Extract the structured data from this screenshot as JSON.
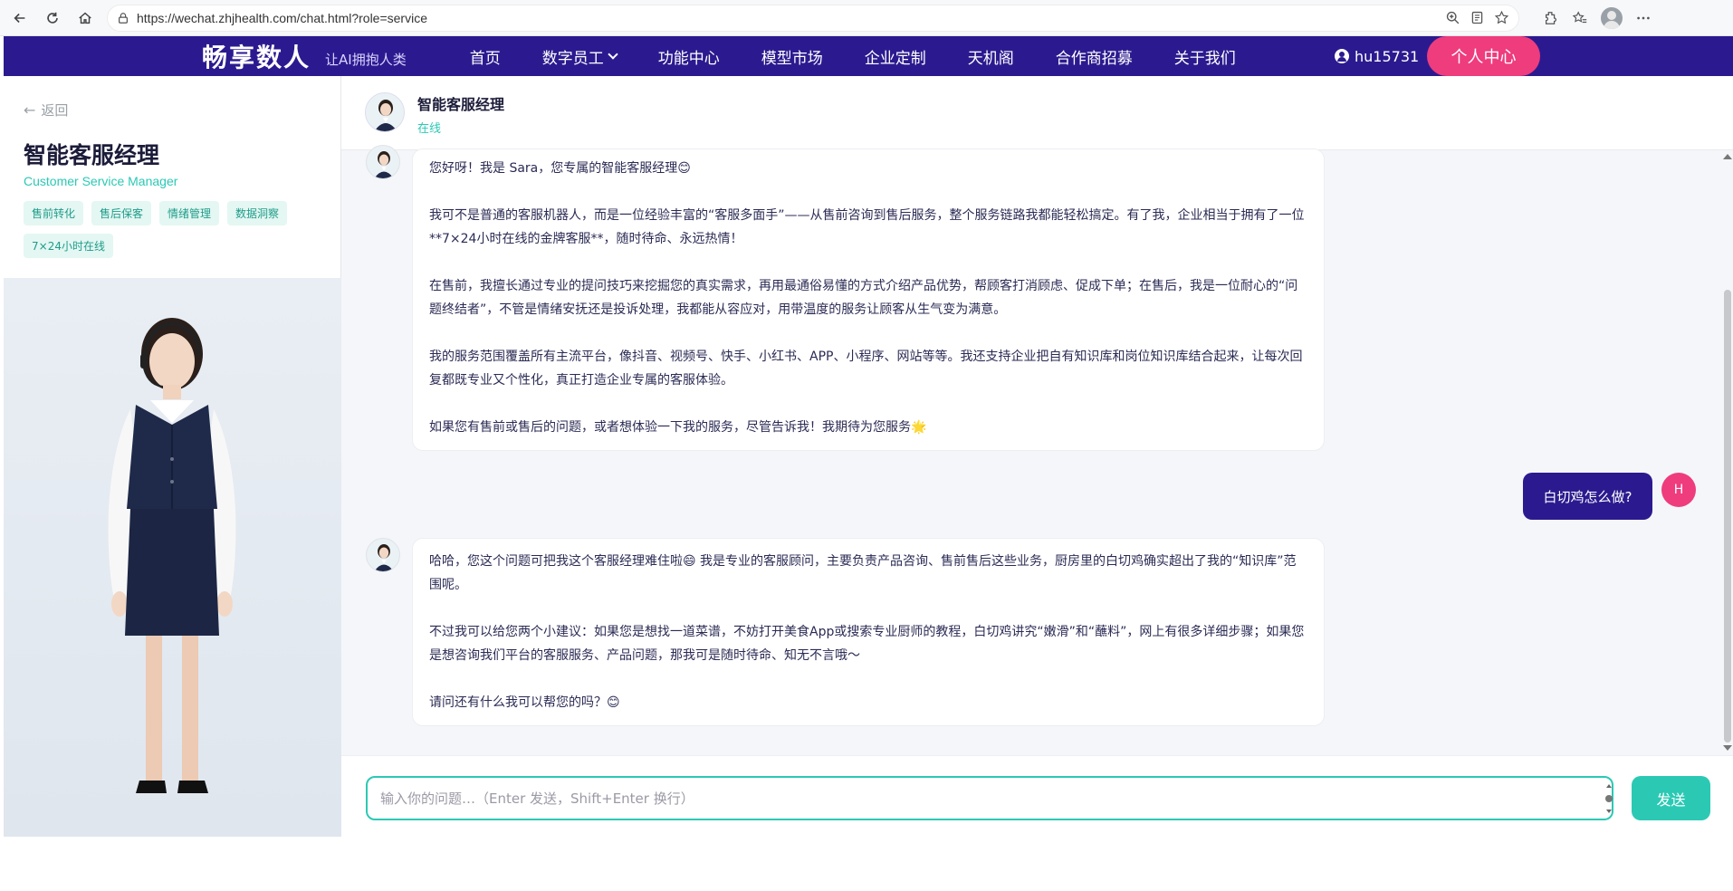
{
  "browser": {
    "url": "https://wechat.zhjhealth.com/chat.html?role=service"
  },
  "header": {
    "brand": "畅享数人",
    "slogan": "让AI拥抱人类",
    "nav": [
      {
        "label": "首页"
      },
      {
        "label": "数字员工"
      },
      {
        "label": "功能中心"
      },
      {
        "label": "模型市场"
      },
      {
        "label": "企业定制"
      },
      {
        "label": "天机阁"
      },
      {
        "label": "合作商招募"
      },
      {
        "label": "关于我们"
      }
    ],
    "username": "hu15731",
    "personal_center": "个人中心"
  },
  "sidebar": {
    "back": "返回",
    "title": "智能客服经理",
    "subtitle": "Customer Service Manager",
    "tags": [
      "售前转化",
      "售后保客",
      "情绪管理",
      "数据洞察",
      "7×24小时在线"
    ]
  },
  "chat": {
    "name": "智能客服经理",
    "status": "在线",
    "messages": [
      {
        "role": "bot",
        "paragraphs": [
          "您好呀！我是 Sara，您专属的智能客服经理😊",
          "我可不是普通的客服机器人，而是一位经验丰富的“客服多面手”——从售前咨询到售后服务，整个服务链路我都能轻松搞定。有了我，企业相当于拥有了一位**7×24小时在线的金牌客服**，随时待命、永远热情！",
          "在售前，我擅长通过专业的提问技巧来挖掘您的真实需求，再用最通俗易懂的方式介绍产品优势，帮顾客打消顾虑、促成下单；在售后，我是一位耐心的“问题终结者”，不管是情绪安抚还是投诉处理，我都能从容应对，用带温度的服务让顾客从生气变为满意。",
          "我的服务范围覆盖所有主流平台，像抖音、视频号、快手、小红书、APP、小程序、网站等等。我还支持企业把自有知识库和岗位知识库结合起来，让每次回复都既专业又个性化，真正打造企业专属的客服体验。",
          "如果您有售前或售后的问题，或者想体验一下我的服务，尽管告诉我！我期待为您服务🌟"
        ]
      },
      {
        "role": "user",
        "avatar_letter": "H",
        "text": "白切鸡怎么做?"
      },
      {
        "role": "bot",
        "paragraphs": [
          "哈哈，您这个问题可把我这个客服经理难住啦😄 我是专业的客服顾问，主要负责产品咨询、售前售后这些业务，厨房里的白切鸡确实超出了我的“知识库”范围呢。",
          "不过我可以给您两个小建议：如果您是想找一道菜谱，不妨打开美食App或搜索专业厨师的教程，白切鸡讲究“嫩滑”和“蘸料”，网上有很多详细步骤；如果您是想咨询我们平台的客服服务、产品问题，那我可是随时待命、知无不言哦～",
          "请问还有什么我可以帮您的吗？😊"
        ]
      }
    ]
  },
  "input": {
    "placeholder": "输入你的问题…（Enter 发送，Shift+Enter 换行）",
    "send_label": "发送"
  },
  "colors": {
    "header_bg": "#2b1a8f",
    "accent_teal": "#2bc9b4",
    "accent_pink": "#ee3c7d"
  }
}
